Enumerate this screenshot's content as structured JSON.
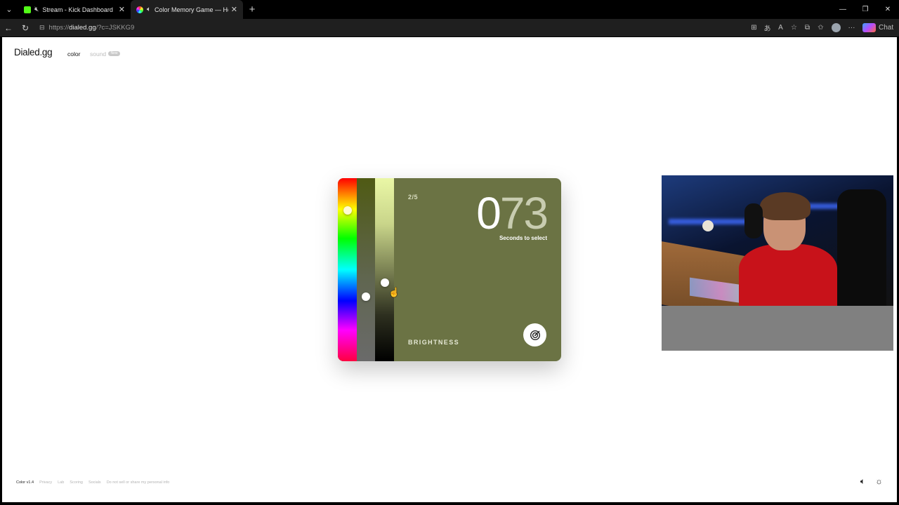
{
  "browser": {
    "tabs": [
      {
        "title": "Stream - Kick Dashboard",
        "favicon": "kick-icon"
      },
      {
        "title": "Color Memory Game — How",
        "favicon": "color-wheel-icon"
      }
    ],
    "url_prefix": "https://",
    "url_host": "dialed.gg",
    "url_path": "/?c=JSKKG9",
    "chat_label": "Chat"
  },
  "site": {
    "logo": "Dialed.gg",
    "nav": {
      "color": "color",
      "sound": "sound",
      "badge": "New"
    }
  },
  "game": {
    "round": "2/5",
    "timer_first_digit": "0",
    "timer_rest": "73",
    "timer_label": "Seconds to select",
    "active_slider": "BRIGHTNESS",
    "card_color": "#6b7344"
  },
  "footer": {
    "version": "Color v1.4",
    "links": [
      "Privacy",
      "Lab",
      "Scoring",
      "Socials",
      "Do not sell or share my personal info"
    ]
  }
}
